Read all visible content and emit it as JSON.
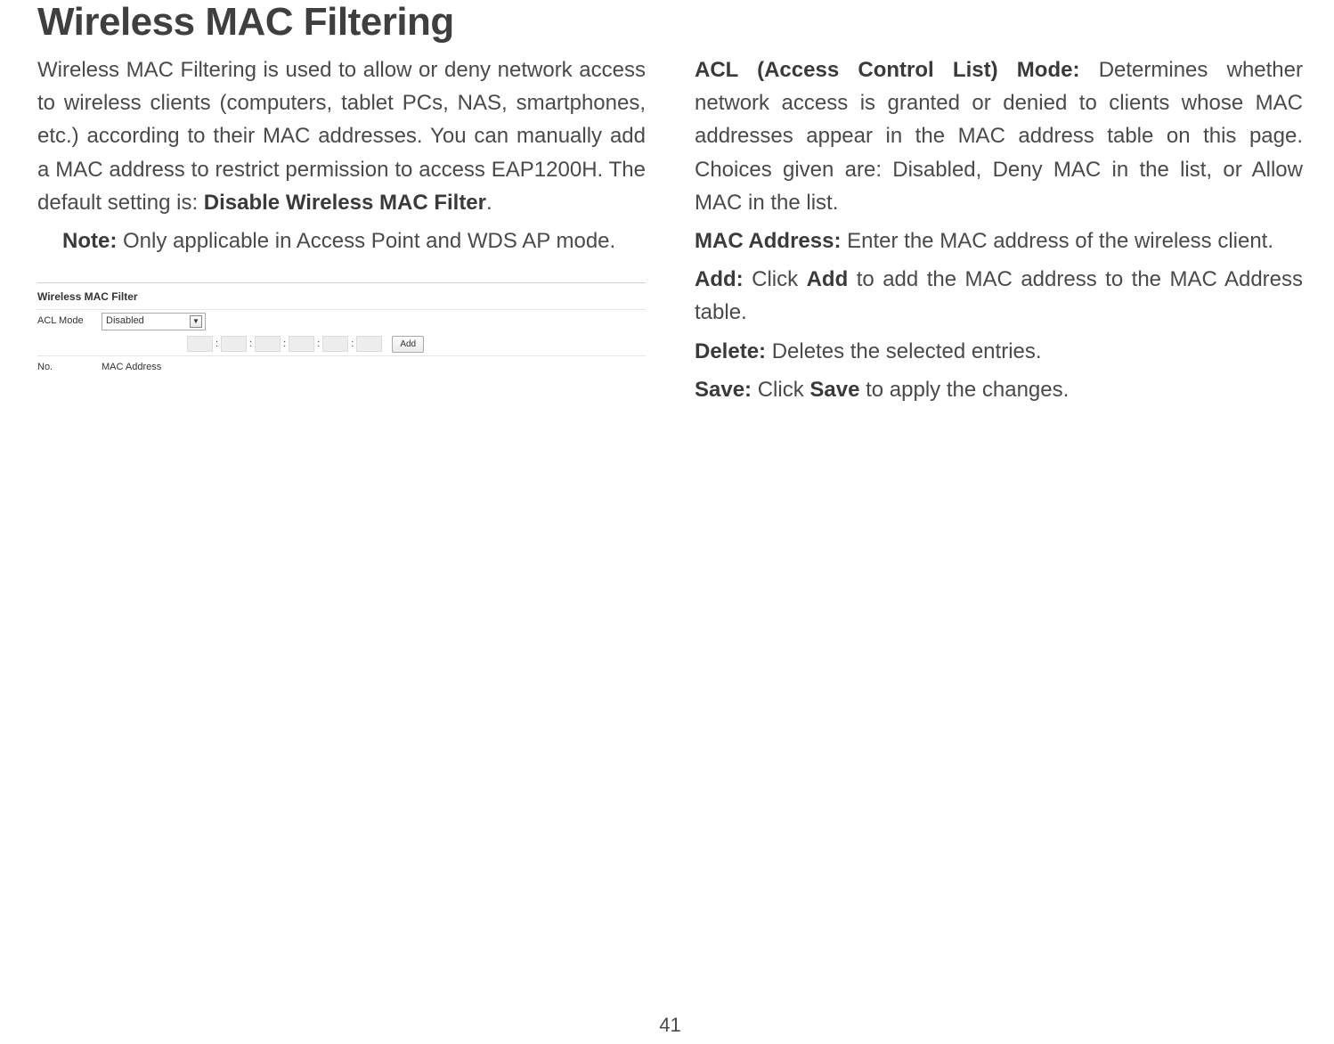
{
  "title": "Wireless MAC Filtering",
  "left": {
    "intro_part1": "Wireless MAC Filtering is used to allow or deny network access to wireless clients (computers, tablet PCs, NAS, smartphones, etc.) according to their MAC addresses. You can manually add a MAC address to restrict permission to access EAP1200H. The default setting is: ",
    "intro_bold": "Disable Wireless MAC Filter",
    "intro_end": ".",
    "note_label": "Note:",
    "note_text": "  Only applicable in Access Point and WDS AP mode."
  },
  "screenshot": {
    "panel_title": "Wireless MAC Filter",
    "acl_label": "ACL Mode",
    "acl_value": "Disabled",
    "add_button": "Add",
    "col_no": "No.",
    "col_mac": "MAC Address"
  },
  "right": {
    "acl_label": "ACL (Access Control List) Mode:",
    "acl_text": " Determines whether network access is granted or denied to clients whose MAC addresses appear in the MAC address table on this page. Choices given are: Disabled, Deny MAC in the list, or Allow MAC in the list.",
    "mac_label": "MAC Address:",
    "mac_text": " Enter the MAC address of the wireless client.",
    "add_label": "Add:",
    "add_text_pre": " Click ",
    "add_bold": "Add",
    "add_text_post": " to add the MAC address to the MAC Address table.",
    "delete_label": "Delete:",
    "delete_text": " Deletes the selected entries.",
    "save_label": "Save:",
    "save_text_pre": " Click ",
    "save_bold": "Save",
    "save_text_post": " to apply the changes."
  },
  "page_number": "41"
}
